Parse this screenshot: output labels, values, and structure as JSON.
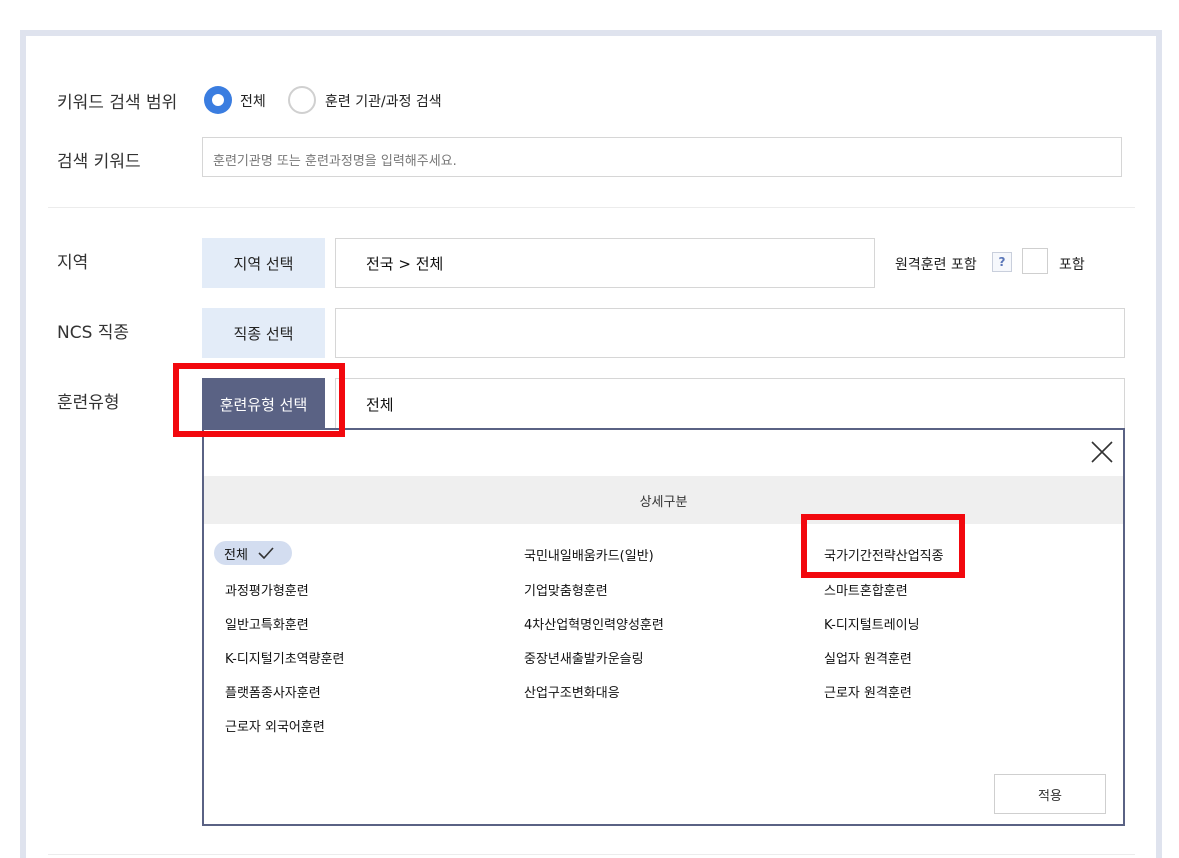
{
  "search_scope": {
    "label": "키워드 검색 범위",
    "options": [
      {
        "label": "전체",
        "selected": true
      },
      {
        "label": "훈련 기관/과정 검색",
        "selected": false
      }
    ]
  },
  "keyword": {
    "label": "검색 키워드",
    "placeholder": "훈련기관명 또는 훈련과정명을 입력해주세요."
  },
  "region": {
    "label": "지역",
    "button": "지역 선택",
    "value": "전국 > 전체",
    "remote_label": "원격훈련 포함",
    "help_icon": "?",
    "include_label": "포함"
  },
  "ncs": {
    "label": "NCS 직종",
    "button": "직종 선택",
    "value": ""
  },
  "training_type": {
    "label": "훈련유형",
    "button": "훈련유형 선택",
    "value": "전체"
  },
  "panel": {
    "header": "상세구분",
    "close_icon": "close-icon",
    "selected_chip": "전체",
    "col1": [
      "과정평가형훈련",
      "일반고특화훈련",
      "K-디지털기초역량훈련",
      "플랫폼종사자훈련",
      "근로자 외국어훈련"
    ],
    "col2": [
      "국민내일배움카드(일반)",
      "기업맞춤형훈련",
      "4차산업혁명인력양성훈련",
      "중장년새출발카운슬링",
      "산업구조변화대응"
    ],
    "col3": [
      "국가기간전략산업직종",
      "스마트혼합훈련",
      "K-디지털트레이닝",
      "실업자 원격훈련",
      "근로자 원격훈련"
    ],
    "apply": "적용"
  },
  "colors": {
    "accent": "#3a7de0",
    "active_button": "#5a6284",
    "highlight": "#f2080e"
  }
}
